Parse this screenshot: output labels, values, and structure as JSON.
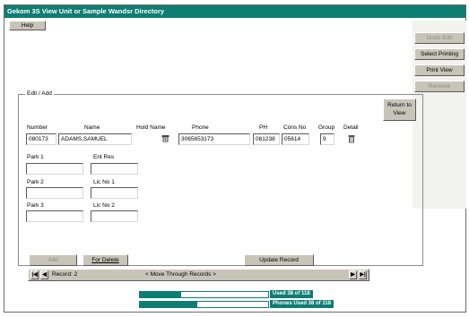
{
  "window": {
    "title": "Gekom 3S  View Unit or Sample Wandsr Directory"
  },
  "toolbar": {
    "help_label": "Help"
  },
  "right_panel": {
    "buttons": [
      {
        "label": "Undo Edit",
        "enabled": false
      },
      {
        "label": "Select Printing",
        "enabled": true
      },
      {
        "label": "Print View",
        "enabled": true
      },
      {
        "label": "Remove",
        "enabled": false
      }
    ]
  },
  "edit_group": {
    "legend": "Edit / Add",
    "return_label": "Return to View",
    "labels": {
      "number": "Number",
      "name": "Name",
      "hold_name": "Hold Name",
      "phone": "Phone",
      "ph": "PH",
      "cons_no": "Cons No",
      "group": "Group",
      "detail": "Detail",
      "park1": "Park 1",
      "ent_res": "Ent Res",
      "park2": "Park 2",
      "lic_no1": "Lic No 1",
      "park3": "Park 3",
      "lic_no2": "Lic No 2"
    },
    "values": {
      "number": "080173",
      "name": "ADAMS,SAMUEL",
      "phone": "3065653173",
      "ph": "081238",
      "cons_no": "05614",
      "group": "9",
      "park1": "",
      "ent_res": "",
      "park2": "",
      "lic_no1": "",
      "park3": "",
      "lic_no2": ""
    }
  },
  "actions": {
    "add_label": "Add",
    "delete_label": "For Delete",
    "update_label": "Update Record"
  },
  "navigator": {
    "first": "|◀",
    "prev": "◀",
    "record_label": "Record: 2",
    "move_label": "< Move Through Records >",
    "next": "▶",
    "last": "▶|"
  },
  "status": {
    "progress1_label": "Used 38 of 118",
    "progress1_value": 0.32,
    "progress2_label": "Phones Used 38 of 118",
    "progress2_value": 0.45
  },
  "colors": {
    "accent": "#0f7d72",
    "button_face": "#c8c4b8"
  },
  "icons": {
    "hold_name": "phone-icon",
    "detail": "trash-icon"
  }
}
